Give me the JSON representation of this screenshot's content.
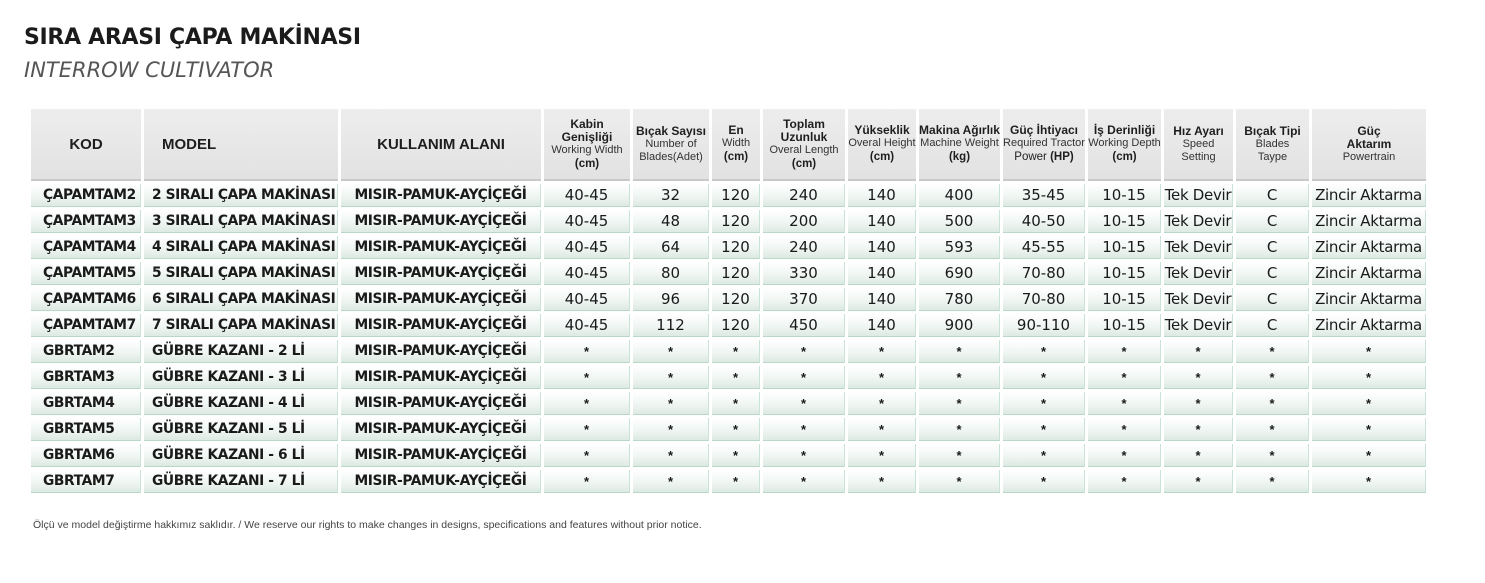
{
  "title": "SIRA ARASI ÇAPA MAKİNASI",
  "subtitle": "INTERROW CULTIVATOR",
  "headers": {
    "kod": "KOD",
    "model": "MODEL",
    "kullanim": "KULLANIM ALANI",
    "kabin": {
      "tr": "Kabin Genişliği",
      "en": "Working Width",
      "unit": "(cm)"
    },
    "bicak": {
      "tr": "Bıçak Sayısı",
      "en": "Number of",
      "unit": "Blades(Adet)"
    },
    "en": {
      "tr": "En",
      "en": "Width",
      "unit": "(cm)"
    },
    "uzunluk": {
      "tr": "Toplam Uzunluk",
      "en": "Overal Length",
      "unit": "(cm)"
    },
    "yukseklik": {
      "tr": "Yükseklik",
      "en": "Overal Height",
      "unit": "(cm)"
    },
    "agirlik": {
      "tr": "Makina Ağırlık",
      "en": "Machine Weight",
      "unit": "(kg)"
    },
    "guc": {
      "tr": "Güç İhtiyacı",
      "en": "Required Tractor",
      "unit_pre": "Power ",
      "unit": "(HP)"
    },
    "derinlik": {
      "tr": "İş Derinliği",
      "en": "Working Depth",
      "unit": "(cm)"
    },
    "hiz": {
      "tr": "Hız Ayarı",
      "en": "Speed",
      "unit": "Setting"
    },
    "tip": {
      "tr": "Bıçak Tipi",
      "en": "Blades",
      "unit": "Taype"
    },
    "aktarim": {
      "tr": "Güç",
      "en": "Aktarım",
      "unit": "Powertrain"
    }
  },
  "rows": [
    {
      "kod": "ÇAPAMTAM2",
      "model": "2 SIRALI ÇAPA MAKİNASI",
      "area": "MISIR-PAMUK-AYÇİÇEĞİ",
      "kabin": "40-45",
      "bicak": "32",
      "en": "120",
      "uzunluk": "240",
      "yukseklik": "140",
      "agirlik": "400",
      "guc": "35-45",
      "derinlik": "10-15",
      "hiz": "Tek Devir",
      "tip": "C",
      "aktarim": "Zincir Aktarma"
    },
    {
      "kod": "ÇAPAMTAM3",
      "model": "3 SIRALI ÇAPA MAKİNASI",
      "area": "MISIR-PAMUK-AYÇİÇEĞİ",
      "kabin": "40-45",
      "bicak": "48",
      "en": "120",
      "uzunluk": "200",
      "yukseklik": "140",
      "agirlik": "500",
      "guc": "40-50",
      "derinlik": "10-15",
      "hiz": "Tek Devir",
      "tip": "C",
      "aktarim": "Zincir Aktarma"
    },
    {
      "kod": "ÇAPAMTAM4",
      "model": "4 SIRALI ÇAPA MAKİNASI",
      "area": "MISIR-PAMUK-AYÇİÇEĞİ",
      "kabin": "40-45",
      "bicak": "64",
      "en": "120",
      "uzunluk": "240",
      "yukseklik": "140",
      "agirlik": "593",
      "guc": "45-55",
      "derinlik": "10-15",
      "hiz": "Tek Devir",
      "tip": "C",
      "aktarim": "Zincir Aktarma"
    },
    {
      "kod": "ÇAPAMTAM5",
      "model": "5 SIRALI ÇAPA MAKİNASI",
      "area": "MISIR-PAMUK-AYÇİÇEĞİ",
      "kabin": "40-45",
      "bicak": "80",
      "en": "120",
      "uzunluk": "330",
      "yukseklik": "140",
      "agirlik": "690",
      "guc": "70-80",
      "derinlik": "10-15",
      "hiz": "Tek Devir",
      "tip": "C",
      "aktarim": "Zincir Aktarma"
    },
    {
      "kod": "ÇAPAMTAM6",
      "model": "6 SIRALI ÇAPA MAKİNASI",
      "area": "MISIR-PAMUK-AYÇİÇEĞİ",
      "kabin": "40-45",
      "bicak": "96",
      "en": "120",
      "uzunluk": "370",
      "yukseklik": "140",
      "agirlik": "780",
      "guc": "70-80",
      "derinlik": "10-15",
      "hiz": "Tek Devir",
      "tip": "C",
      "aktarim": "Zincir Aktarma"
    },
    {
      "kod": "ÇAPAMTAM7",
      "model": "7 SIRALI ÇAPA MAKİNASI",
      "area": "MISIR-PAMUK-AYÇİÇEĞİ",
      "kabin": "40-45",
      "bicak": "112",
      "en": "120",
      "uzunluk": "450",
      "yukseklik": "140",
      "agirlik": "900",
      "guc": "90-110",
      "derinlik": "10-15",
      "hiz": "Tek Devir",
      "tip": "C",
      "aktarim": "Zincir Aktarma"
    },
    {
      "kod": "GBRTAM2",
      "model": "GÜBRE KAZANI - 2 Lİ",
      "area": "MISIR-PAMUK-AYÇİÇEĞİ",
      "kabin": "*",
      "bicak": "*",
      "en": "*",
      "uzunluk": "*",
      "yukseklik": "*",
      "agirlik": "*",
      "guc": "*",
      "derinlik": "*",
      "hiz": "*",
      "tip": "*",
      "aktarim": "*"
    },
    {
      "kod": "GBRTAM3",
      "model": "GÜBRE KAZANI - 3 Lİ",
      "area": "MISIR-PAMUK-AYÇİÇEĞİ",
      "kabin": "*",
      "bicak": "*",
      "en": "*",
      "uzunluk": "*",
      "yukseklik": "*",
      "agirlik": "*",
      "guc": "*",
      "derinlik": "*",
      "hiz": "*",
      "tip": "*",
      "aktarim": "*"
    },
    {
      "kod": "GBRTAM4",
      "model": "GÜBRE KAZANI - 4 Lİ",
      "area": "MISIR-PAMUK-AYÇİÇEĞİ",
      "kabin": "*",
      "bicak": "*",
      "en": "*",
      "uzunluk": "*",
      "yukseklik": "*",
      "agirlik": "*",
      "guc": "*",
      "derinlik": "*",
      "hiz": "*",
      "tip": "*",
      "aktarim": "*"
    },
    {
      "kod": "GBRTAM5",
      "model": "GÜBRE KAZANI - 5 Lİ",
      "area": "MISIR-PAMUK-AYÇİÇEĞİ",
      "kabin": "*",
      "bicak": "*",
      "en": "*",
      "uzunluk": "*",
      "yukseklik": "*",
      "agirlik": "*",
      "guc": "*",
      "derinlik": "*",
      "hiz": "*",
      "tip": "*",
      "aktarim": "*"
    },
    {
      "kod": "GBRTAM6",
      "model": "GÜBRE KAZANI - 6 Lİ",
      "area": "MISIR-PAMUK-AYÇİÇEĞİ",
      "kabin": "*",
      "bicak": "*",
      "en": "*",
      "uzunluk": "*",
      "yukseklik": "*",
      "agirlik": "*",
      "guc": "*",
      "derinlik": "*",
      "hiz": "*",
      "tip": "*",
      "aktarim": "*"
    },
    {
      "kod": "GBRTAM7",
      "model": "GÜBRE KAZANI - 7 Lİ",
      "area": "MISIR-PAMUK-AYÇİÇEĞİ",
      "kabin": "*",
      "bicak": "*",
      "en": "*",
      "uzunluk": "*",
      "yukseklik": "*",
      "agirlik": "*",
      "guc": "*",
      "derinlik": "*",
      "hiz": "*",
      "tip": "*",
      "aktarim": "*"
    }
  ],
  "footnote": "Ölçü ve model değiştirme hakkımız saklıdır. / We reserve our rights to make changes in designs, specifications and features without prior notice.",
  "colors": {
    "row_border": "#b9d7c7",
    "header_bg": "#e6e6e6"
  }
}
